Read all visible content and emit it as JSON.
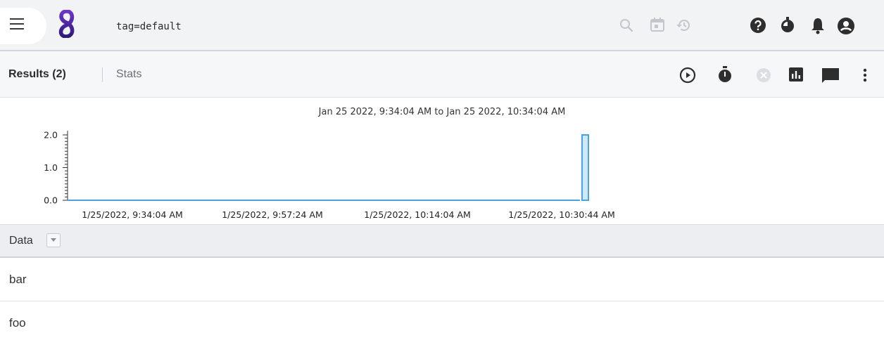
{
  "search": {
    "query": "tag=default"
  },
  "icons": {
    "menu": "hamburger-menu-icon",
    "logo": "gravwell-logo",
    "search": "search-icon",
    "calendar": "calendar-icon",
    "history": "history-icon",
    "help": "help-icon",
    "timer": "timer-icon",
    "notifications": "bell-icon",
    "account": "account-icon"
  },
  "results_bar": {
    "results_tab": "Results (2)",
    "stats_tab": "Stats",
    "tools": [
      "play-icon",
      "stopwatch-icon",
      "cancel-icon",
      "chart-icon",
      "comment-icon",
      "more-vert-icon"
    ]
  },
  "chart_data": {
    "type": "bar",
    "title": "Jan 25 2022, 9:34:04 AM to Jan 25 2022, 10:34:04 AM",
    "ylim": [
      0,
      2
    ],
    "yticks": [
      "2.0",
      "1.0",
      "0.0"
    ],
    "xticks": [
      "1/25/2022, 9:34:04 AM",
      "1/25/2022, 9:57:24 AM",
      "1/25/2022, 10:14:04 AM",
      "1/25/2022, 10:30:44 AM"
    ],
    "series": [
      {
        "values": [
          0,
          2
        ]
      }
    ],
    "bar_time": "1/25/2022, 10:34:04 AM",
    "color": "#4aa3df",
    "fill": "#cfe8f7",
    "grid": false
  },
  "table": {
    "column": "Data",
    "rows": [
      "bar",
      "foo"
    ]
  }
}
